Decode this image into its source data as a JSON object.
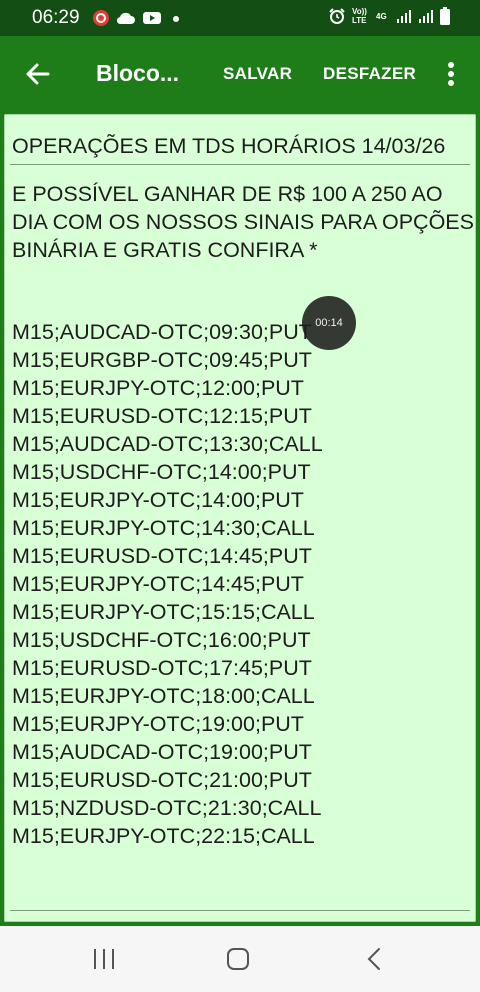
{
  "status_bar": {
    "time": "06:29",
    "icons_left": [
      "notification-app-icon",
      "cloud-icon",
      "youtube-icon",
      "dot-icon"
    ],
    "volte_label": "Vo)) LTE",
    "network_label": "4G",
    "icons_right": [
      "alarm-icon",
      "signal-icon",
      "signal-icon",
      "battery-icon"
    ]
  },
  "app_bar": {
    "title": "Bloco...",
    "save_label": "SALVAR",
    "undo_label": "DESFAZER",
    "colors": {
      "status_bar": "#134e15",
      "app_bar": "#1f7d19",
      "note_background": "#d8ffd6"
    }
  },
  "note": {
    "title": "OPERAÇÕES EM TDS HORÁRIOS 14/03/26",
    "intro": "E POSSÍVEL GANHAR DE R$ 100 A 250 AO DIA COM OS NOSSOS SINAIS PARA OPÇÕES BINÁRIA E GRATIS CONFIRA *",
    "signals": [
      "M15;AUDCAD-OTC;09:30;PUT",
      "M15;EURGBP-OTC;09:45;PUT",
      "M15;EURJPY-OTC;12:00;PUT",
      "M15;EURUSD-OTC;12:15;PUT",
      "M15;AUDCAD-OTC;13:30;CALL",
      "M15;USDCHF-OTC;14:00;PUT",
      "M15;EURJPY-OTC;14:00;PUT",
      "M15;EURJPY-OTC;14:30;CALL",
      "M15;EURUSD-OTC;14:45;PUT",
      "M15;EURJPY-OTC;14:45;PUT",
      "M15;EURJPY-OTC;15:15;CALL",
      "M15;USDCHF-OTC;16:00;PUT",
      "M15;EURUSD-OTC;17:45;PUT",
      "M15;EURJPY-OTC;18:00;CALL",
      "M15;EURJPY-OTC;19:00;PUT",
      "M15;AUDCAD-OTC;19:00;PUT",
      "M15;EURUSD-OTC;21:00;PUT",
      "M15;NZDUSD-OTC;21:30;CALL",
      "M15;EURJPY-OTC;22:15;CALL"
    ]
  },
  "timer": {
    "value": "00:14"
  },
  "nav_bar": {
    "icons": [
      "recents-icon",
      "home-icon",
      "back-icon"
    ]
  }
}
